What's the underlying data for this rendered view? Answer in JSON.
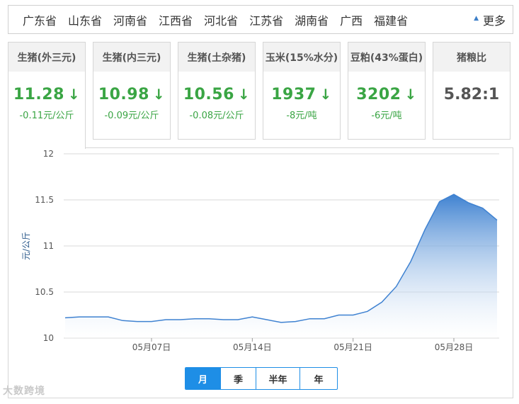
{
  "provinces": [
    "广东省",
    "山东省",
    "河南省",
    "江西省",
    "河北省",
    "江苏省",
    "湖南省",
    "广西",
    "福建省"
  ],
  "more_label": "更多",
  "cards": [
    {
      "title": "生猪(外三元)",
      "value": "11.28",
      "change": "-0.11元/公斤",
      "trend": "down"
    },
    {
      "title": "生猪(内三元)",
      "value": "10.98",
      "change": "-0.09元/公斤",
      "trend": "down"
    },
    {
      "title": "生猪(土杂猪)",
      "value": "10.56",
      "change": "-0.08元/公斤",
      "trend": "down"
    },
    {
      "title": "玉米(15%水分)",
      "value": "1937",
      "change": "-8元/吨",
      "trend": "down"
    },
    {
      "title": "豆粕(43%蛋白)",
      "value": "3202",
      "change": "-6元/吨",
      "trend": "down"
    }
  ],
  "ratio_card": {
    "title": "猪粮比",
    "value": "5.82:1"
  },
  "range_tabs": [
    "月",
    "季",
    "半年",
    "年"
  ],
  "active_range": "月",
  "watermark": "大数跨境",
  "colors": {
    "accent": "#1e8ee6",
    "down": "#3aa544",
    "line": "#3f82d1"
  },
  "icons": {
    "down_arrow": "down-arrow-icon",
    "more_triangle": "triangle-up-icon"
  },
  "chart_data": {
    "type": "area",
    "title": "",
    "xlabel": "",
    "ylabel": "元/公斤",
    "ylim": [
      10,
      12
    ],
    "yticks": [
      "10",
      "10.5",
      "11",
      "11.5",
      "12"
    ],
    "xticks": [
      "05月07日",
      "05月14日",
      "05月21日",
      "05月28日"
    ],
    "grid": true,
    "series": [
      {
        "x": [
          "05/01",
          "05/02",
          "05/03",
          "05/04",
          "05/05",
          "05/06",
          "05/07",
          "05/08",
          "05/09",
          "05/10",
          "05/11",
          "05/12",
          "05/13",
          "05/14",
          "05/15",
          "05/16",
          "05/17",
          "05/18",
          "05/19",
          "05/20",
          "05/21",
          "05/22",
          "05/23",
          "05/24",
          "05/25",
          "05/26",
          "05/27",
          "05/28",
          "05/29",
          "05/30",
          "05/31"
        ],
        "values": [
          10.22,
          10.23,
          10.23,
          10.23,
          10.19,
          10.18,
          10.18,
          10.2,
          10.2,
          10.21,
          10.21,
          10.2,
          10.2,
          10.23,
          10.2,
          10.17,
          10.18,
          10.21,
          10.21,
          10.25,
          10.25,
          10.29,
          10.39,
          10.56,
          10.83,
          11.18,
          11.48,
          11.56,
          11.47,
          11.41,
          11.28
        ]
      }
    ]
  }
}
